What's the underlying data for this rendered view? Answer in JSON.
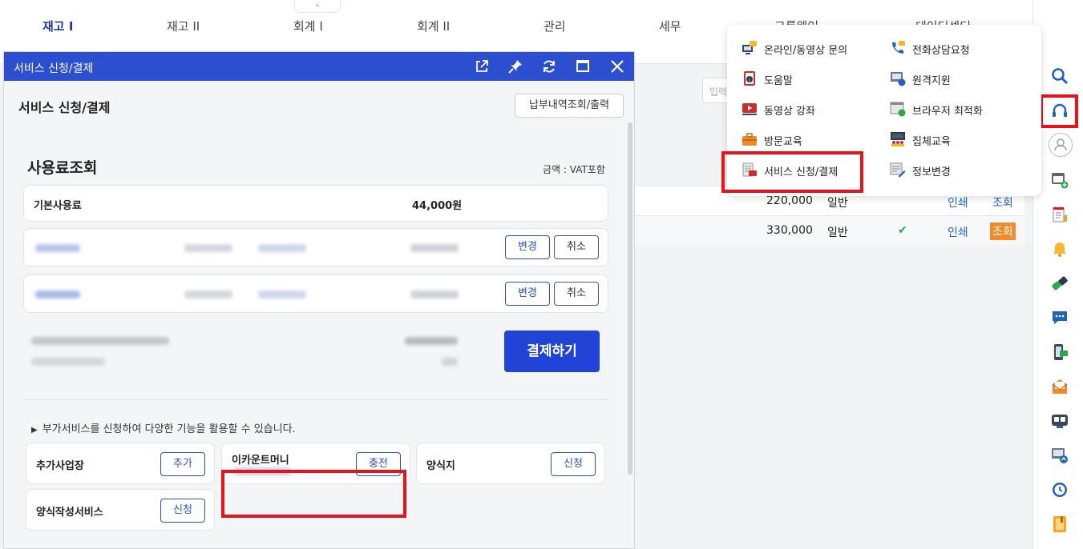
{
  "top_nav": {
    "tabs": [
      {
        "label": "재고 I",
        "active": true
      },
      {
        "label": "재고 II",
        "active": false
      },
      {
        "label": "회계 I",
        "active": false
      },
      {
        "label": "회계 II",
        "active": false
      },
      {
        "label": "관리",
        "active": false
      },
      {
        "label": "세무",
        "active": false
      },
      {
        "label": "그룹웨어",
        "active": false
      },
      {
        "label": "데이터센터",
        "active": false
      }
    ]
  },
  "background": {
    "input_placeholder": "입력",
    "rows": [
      {
        "amount": "220,000",
        "type": "일반",
        "checked": false,
        "print": "인쇄",
        "view": "조회"
      },
      {
        "amount": "330,000",
        "type": "일반",
        "checked": true,
        "print": "인쇄",
        "view": "조회"
      }
    ],
    "check_mark": "✔"
  },
  "dialog": {
    "title": "서비스 신청/결제",
    "heading": "서비스 신청/결제",
    "history_button": "납부내역조회/출력",
    "fee_title": "사용료조회",
    "fee_note": "금액 : VAT포함",
    "basic_fee": {
      "label": "기본사용료",
      "amount": "44,000원"
    },
    "service_rows": [
      {
        "change": "변경",
        "cancel": "취소"
      },
      {
        "change": "변경",
        "cancel": "취소"
      }
    ],
    "pay_button": "결제하기",
    "addon_note": "부가서비스를 신청하여 다양한 기능을 활용할 수 있습니다.",
    "addons": [
      {
        "label": "추가사업장",
        "button": "추가"
      },
      {
        "label": "이카운트머니",
        "button": "충전"
      },
      {
        "label": "양식지",
        "button": "신청"
      },
      {
        "label": "양식작성서비스",
        "button": "신청"
      }
    ]
  },
  "popup_menu": {
    "left": [
      "온라인/동영상 문의",
      "도움말",
      "동영상 강좌",
      "방문교육",
      "서비스 신청/결제"
    ],
    "right": [
      "전화상담요청",
      "원격지원",
      "브라우저 최적화",
      "집체교육",
      "정보변경"
    ]
  },
  "colors": {
    "primary": "#2b4fce",
    "highlight": "#e8121b",
    "accent_orange": "#f08a2a"
  }
}
